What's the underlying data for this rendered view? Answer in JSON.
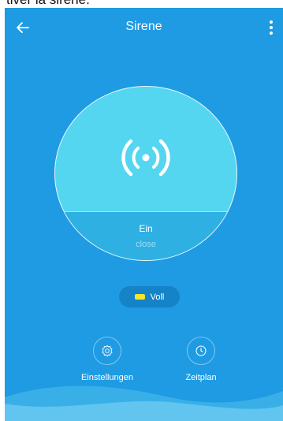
{
  "caption": "tiver la sirène.",
  "header": {
    "title": "Sirene",
    "back_icon": "arrow-left-icon",
    "menu_icon": "more-vertical-icon"
  },
  "device": {
    "icon": "siren-icon",
    "state": "Ein",
    "substate": "close"
  },
  "battery": {
    "label": "Voll",
    "icon": "battery-icon",
    "color": "#f2e52b"
  },
  "actions": [
    {
      "label": "Einstellungen",
      "icon": "gear-icon"
    },
    {
      "label": "Zeitplan",
      "icon": "clock-icon"
    }
  ],
  "colors": {
    "background": "#1e9be3",
    "circle": "#55d6f0",
    "circle_bottom": "#2fb0e3",
    "pill": "#1583c7"
  }
}
